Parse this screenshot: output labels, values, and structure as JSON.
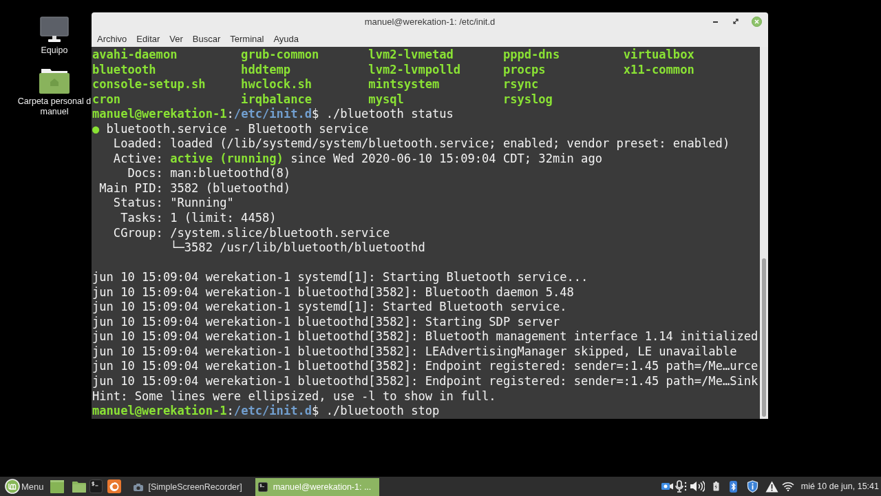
{
  "desktop": {
    "icons": [
      {
        "kind": "computer",
        "label": "Equipo"
      },
      {
        "kind": "home",
        "label": "Carpeta personal d manuel"
      }
    ]
  },
  "window": {
    "title": "manuel@werekation-1: /etc/init.d",
    "menu": [
      "Archivo",
      "Editar",
      "Ver",
      "Buscar",
      "Terminal",
      "Ayuda"
    ]
  },
  "terminal": {
    "listing": [
      [
        "avahi-daemon",
        "grub-common",
        "lvm2-lvmetad",
        "pppd-dns",
        "virtualbox"
      ],
      [
        "bluetooth",
        "hddtemp",
        "lvm2-lvmpolld",
        "procps",
        "x11-common"
      ],
      [
        "console-setup.sh",
        "hwclock.sh",
        "mintsystem",
        "rsync"
      ],
      [
        "cron",
        "irqbalance",
        "mysql",
        "rsyslog"
      ]
    ],
    "prompt": [
      {
        "kind": "user",
        "text": "manuel@werekation-1"
      },
      {
        "kind": "plain",
        "text": ":"
      },
      {
        "kind": "path",
        "text": "/etc/init.d"
      },
      {
        "kind": "plain",
        "text": "$ ./bluetooth status"
      }
    ],
    "status": {
      "bullet": "●",
      "unit": "bluetooth.service - Bluetooth service",
      "properties": [
        {
          "label": "Loaded:",
          "value": [
            {
              "kind": "plain",
              "text": "loaded (/lib/systemd/system/bluetooth.service; enabled; vendor preset: enabled)"
            }
          ]
        },
        {
          "label": "Active:",
          "value": [
            {
              "kind": "active",
              "text": "active (running)"
            },
            {
              "kind": "plain",
              "text": " since Wed 2020-06-10 15:09:04 CDT; 32min ago"
            }
          ]
        },
        {
          "label": "Docs:",
          "value": [
            {
              "kind": "plain",
              "text": "man:bluetoothd(8)"
            }
          ]
        },
        {
          "label": "Main PID:",
          "value": [
            {
              "kind": "plain",
              "text": "3582 (bluetoothd)"
            }
          ]
        },
        {
          "label": "Status:",
          "value": [
            {
              "kind": "plain",
              "text": "\"Running\""
            }
          ]
        },
        {
          "label": "Tasks:",
          "value": [
            {
              "kind": "plain",
              "text": "1 (limit: 4458)"
            }
          ]
        },
        {
          "label": "CGroup:",
          "value": [
            {
              "kind": "plain",
              "text": "/system.slice/bluetooth.service"
            }
          ]
        },
        {
          "value": [
            {
              "kind": "plain",
              "text": "└─3582 /usr/lib/bluetooth/bluetoothd"
            }
          ]
        }
      ]
    },
    "journal": [
      "jun 10 15:09:04 werekation-1 systemd[1]: Starting Bluetooth service...",
      "jun 10 15:09:04 werekation-1 bluetoothd[3582]: Bluetooth daemon 5.48",
      "jun 10 15:09:04 werekation-1 systemd[1]: Started Bluetooth service.",
      "jun 10 15:09:04 werekation-1 bluetoothd[3582]: Starting SDP server",
      "jun 10 15:09:04 werekation-1 bluetoothd[3582]: Bluetooth management interface 1.14 initialized",
      "jun 10 15:09:04 werekation-1 bluetoothd[3582]: LEAdvertisingManager skipped, LE unavailable",
      "jun 10 15:09:04 werekation-1 bluetoothd[3582]: Endpoint registered: sender=:1.45 path=/Me…urce",
      "jun 10 15:09:04 werekation-1 bluetoothd[3582]: Endpoint registered: sender=:1.45 path=/Me…Sink"
    ],
    "hint": "Hint: Some lines were ellipsized, use -l to show in full.",
    "last_prompt": [
      {
        "kind": "user",
        "text": "manuel@werekation-1"
      },
      {
        "kind": "plain",
        "text": ":"
      },
      {
        "kind": "path",
        "text": "/etc/init.d"
      },
      {
        "kind": "plain",
        "text": "$ ./bluetooth stop"
      }
    ]
  },
  "taskbar": {
    "menu_button": "Menu",
    "windows": [
      {
        "kind": "recorder",
        "label": "[SimpleScreenRecorder]",
        "selected": false
      },
      {
        "kind": "terminal",
        "label": "manuel@werekation-1: ...",
        "selected": true
      }
    ],
    "clock": "mié 10 de jun, 15:41"
  }
}
